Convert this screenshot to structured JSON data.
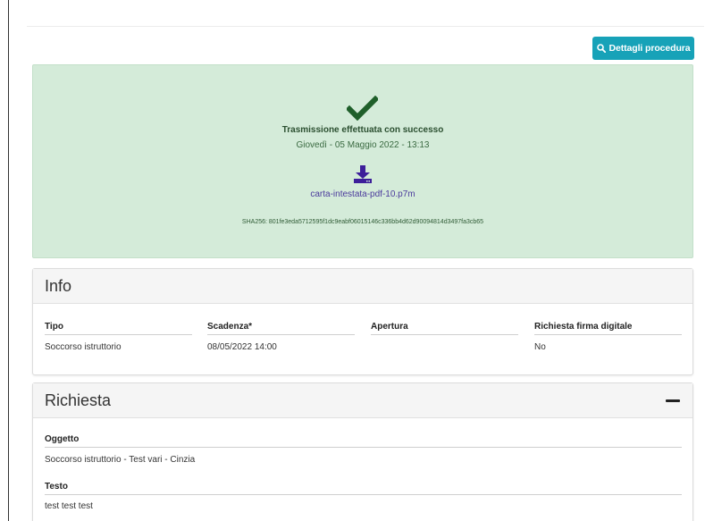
{
  "toolbar": {
    "dettagli_label": "Dettagli procedura"
  },
  "success": {
    "title": "Trasmissione effettuata con successo",
    "date": "Giovedì - 05 Maggio 2022 - 13:13",
    "file_name": "carta-intestata-pdf-10.p7m",
    "sha": "SHA256: 801fe3eda5712595f1dc9eabf06015146c336bb4d62d90094814d3497fa3cb65"
  },
  "info": {
    "title": "Info",
    "columns": [
      {
        "header": "Tipo",
        "value": "Soccorso istruttorio"
      },
      {
        "header": "Scadenza*",
        "value": "08/05/2022 14:00"
      },
      {
        "header": "Apertura",
        "value": ""
      },
      {
        "header": "Richiesta firma digitale",
        "value": "No"
      }
    ]
  },
  "richiesta": {
    "title": "Richiesta",
    "oggetto_label": "Oggetto",
    "oggetto_value": "Soccorso istruttorio - Test vari - Cinzia",
    "testo_label": "Testo",
    "testo_value": "test test test"
  },
  "colors": {
    "accent": "#17a2b8",
    "success_bg": "#d4ebd9",
    "check": "#1f5f2a",
    "download": "#3d1f9a"
  }
}
